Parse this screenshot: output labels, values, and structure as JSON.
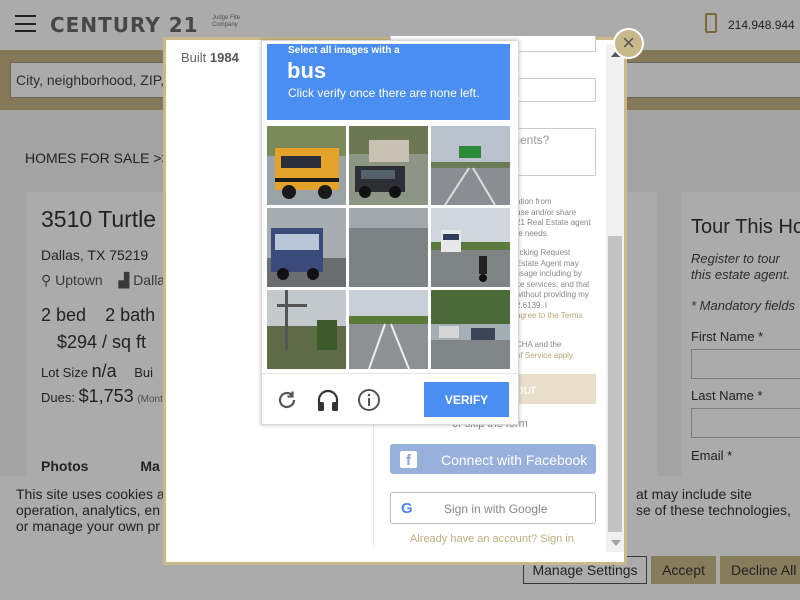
{
  "header": {
    "logo": "CENTURY 21",
    "logo_sub": "Judge Fite Company",
    "phone": "214.948.944"
  },
  "search": {
    "placeholder": "City, neighborhood, ZIP, a"
  },
  "breadcrumb": {
    "text": "HOMES FOR SALE  >>  C"
  },
  "property": {
    "title": "3510 Turtle",
    "city": "Dallas, TX 75219",
    "area": "Uptown",
    "area2": "Dalla",
    "beds": "2 bed",
    "baths": "2 bath",
    "sqft": "$294 / sq ft",
    "lot_label": "Lot Size",
    "lot_value": "n/a",
    "built_trunc": "Bui",
    "dues_label": "Dues:",
    "dues_value": "$1,753",
    "dues_suffix": "(Mont",
    "tab_photos": "Photos",
    "tab_map": "Ma"
  },
  "tour": {
    "title": "Tour This Ho",
    "note": "Register to tour this estate agent.",
    "mandatory": "* Mandatory fields",
    "first_name": "First Name *",
    "last_name": "Last Name *",
    "email": "Email *"
  },
  "cookie": {
    "line1_left": "This site uses cookies a",
    "line1_right": "at may include site",
    "line2_left": "operation, analytics, en",
    "line2_right": "se of these technologies,",
    "line3_left": "or manage your own pr",
    "manage": "Manage Settings",
    "accept": "Accept",
    "decline": "Decline All"
  },
  "modal": {
    "built_label": "Built",
    "built_year": "1984",
    "close": "×",
    "comments_placeholder": "ments?",
    "legal_lines": [
      "ation from",
      "use and/or share",
      "21 Real Estate agent",
      "te needs."
    ],
    "legal_lines2": [
      "licking Request",
      "Estate Agent may",
      "ssage including by",
      "ite services, and that",
      "without providing my",
      "2.6139. I",
      "agree to the Terms"
    ],
    "legal_lines3": [
      "CHA and the",
      "of Service apply."
    ],
    "tour_button": "our",
    "or_skip": "or skip the form",
    "facebook": "Connect with Facebook",
    "google": "Sign in with Google",
    "signin": "Already have an account? Sign in"
  },
  "captcha": {
    "select": "Select all images with a",
    "target": "bus",
    "instruction": "Click verify once there are none left.",
    "verify": "VERIFY",
    "reload_icon": "reload-icon",
    "audio_icon": "headphones-icon",
    "info_icon": "info-icon"
  }
}
